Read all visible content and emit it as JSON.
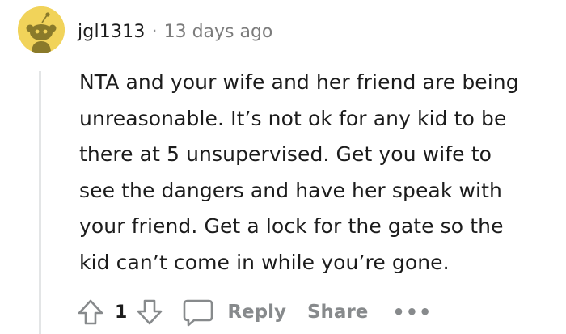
{
  "comment": {
    "username": "jgl1313",
    "separator": "·",
    "timestamp": "13 days ago",
    "body_lines": [
      "NTA and your wife and her friend are being",
      "unreasonable. It’s not ok for any kid to be",
      "there at 5 unsupervised. Get you wife to",
      "see the dangers and have her speak with",
      "your friend. Get a lock for the gate so the",
      "kid can’t come in while you’re gone."
    ],
    "avatar_icon": "snoo-avatar-icon"
  },
  "actions": {
    "upvote_icon": "upvote-arrow-icon",
    "vote_count": "1",
    "downvote_icon": "downvote-arrow-icon",
    "reply_icon": "comment-bubble-icon",
    "reply_label": "Reply",
    "share_label": "Share",
    "more_label": "•••"
  },
  "colors": {
    "avatar_bg": "#f1d35a",
    "action_gray": "#878a8c",
    "text": "#1c1c1c",
    "thread_line": "#e3e5e6"
  }
}
